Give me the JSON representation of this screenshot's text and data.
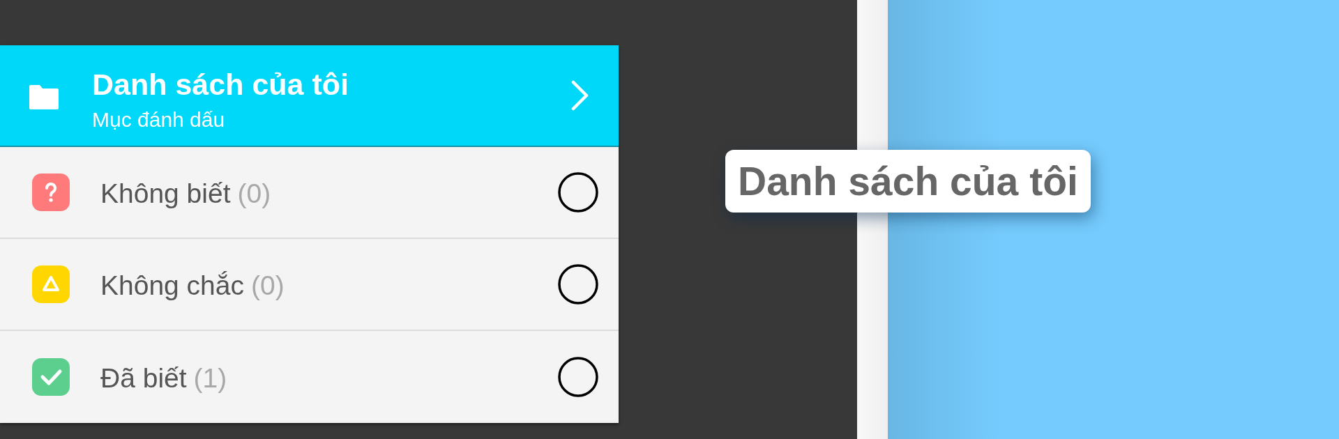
{
  "list_card": {
    "header": {
      "title": "Danh sách của tôi",
      "subtitle": "Mục đánh dấu"
    },
    "rows": [
      {
        "kind": "question",
        "color": "#ff7b7b",
        "label": "Không biết",
        "count": "(0)",
        "checked": false
      },
      {
        "kind": "warning",
        "color": "#ffd600",
        "label": "Không chắc",
        "count": "(0)",
        "checked": false
      },
      {
        "kind": "check",
        "color": "#5ccf8f",
        "label": "Đã biết",
        "count": "(1)",
        "checked": false
      }
    ]
  },
  "tooltip": {
    "text": "Danh sách của tôi"
  }
}
